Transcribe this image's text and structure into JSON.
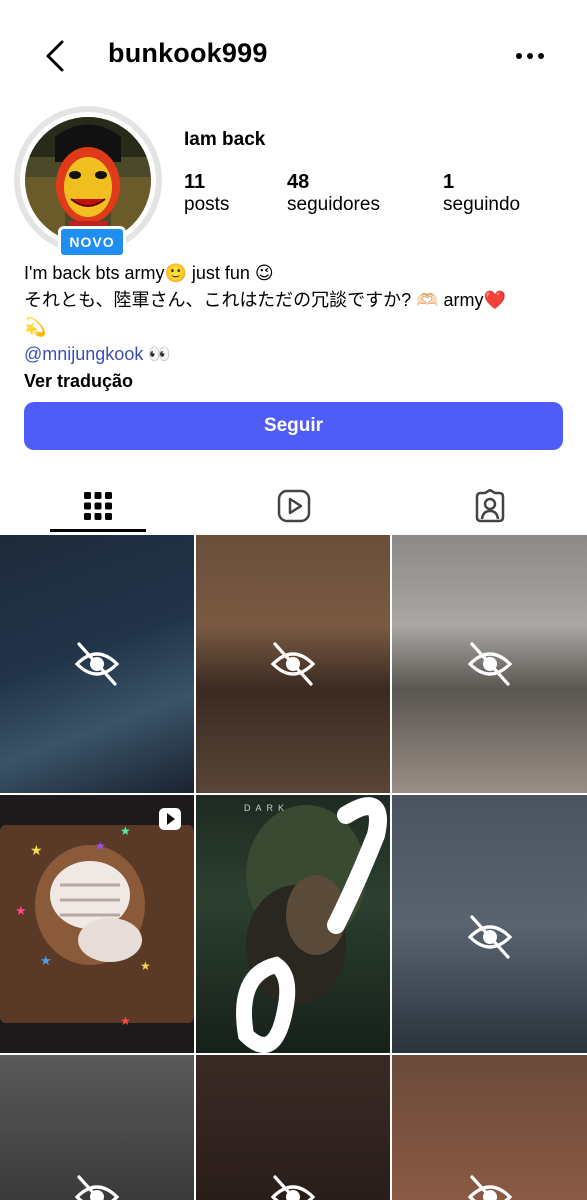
{
  "header": {
    "username": "bunkook999",
    "back_icon": "chevron-left-icon",
    "menu_icon": "more-horizontal-icon"
  },
  "profile": {
    "display_name": "Iam back",
    "badge": "NOVO",
    "stats": [
      {
        "value": "11",
        "label": "posts"
      },
      {
        "value": "48",
        "label": "seguidores"
      },
      {
        "value": "1",
        "label": "seguindo"
      }
    ],
    "bio_lines": [
      "I'm back bts  army🙂 just fun 😉",
      "それとも、陸軍さん、これはただの冗談ですか? 🫶🏻 army❤️",
      "💫"
    ],
    "mention": "@mnijungkook",
    "mention_suffix": " 👀",
    "translate_label": "Ver tradução"
  },
  "actions": {
    "follow_label": "Seguir",
    "follow_color": "#4f5cf5"
  },
  "tabs": [
    {
      "name": "grid",
      "icon": "grid-icon",
      "active": true
    },
    {
      "name": "reels",
      "icon": "reels-icon",
      "active": false
    },
    {
      "name": "tagged",
      "icon": "tagged-person-icon",
      "active": false
    }
  ],
  "grid_posts": {
    "row1": [
      "hidden-post",
      "hidden-post",
      "hidden-post"
    ],
    "row2": [
      "reel-post",
      "visible-post",
      "hidden-post"
    ],
    "row3": [
      "hidden-post",
      "hidden-post",
      "hidden-post"
    ],
    "overlay_text": "DARK",
    "hidden_icon": "eye-off-icon",
    "reel_icon": "play-icon"
  }
}
